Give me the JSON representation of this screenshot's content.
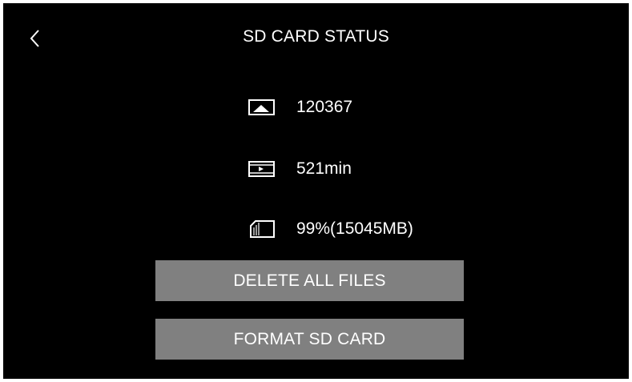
{
  "header": {
    "back_icon": "chevron-left-icon",
    "title": "SD CARD STATUS"
  },
  "stats": {
    "photos": {
      "icon": "image-icon",
      "value": "120367"
    },
    "videos": {
      "icon": "video-icon",
      "value": "521min"
    },
    "storage": {
      "icon": "sd-card-icon",
      "value": "99%(15045MB)"
    }
  },
  "actions": {
    "delete_label": "DELETE ALL FILES",
    "format_label": "FORMAT SD CARD"
  },
  "colors": {
    "background": "#000000",
    "text": "#ffffff",
    "button": "#808080"
  }
}
